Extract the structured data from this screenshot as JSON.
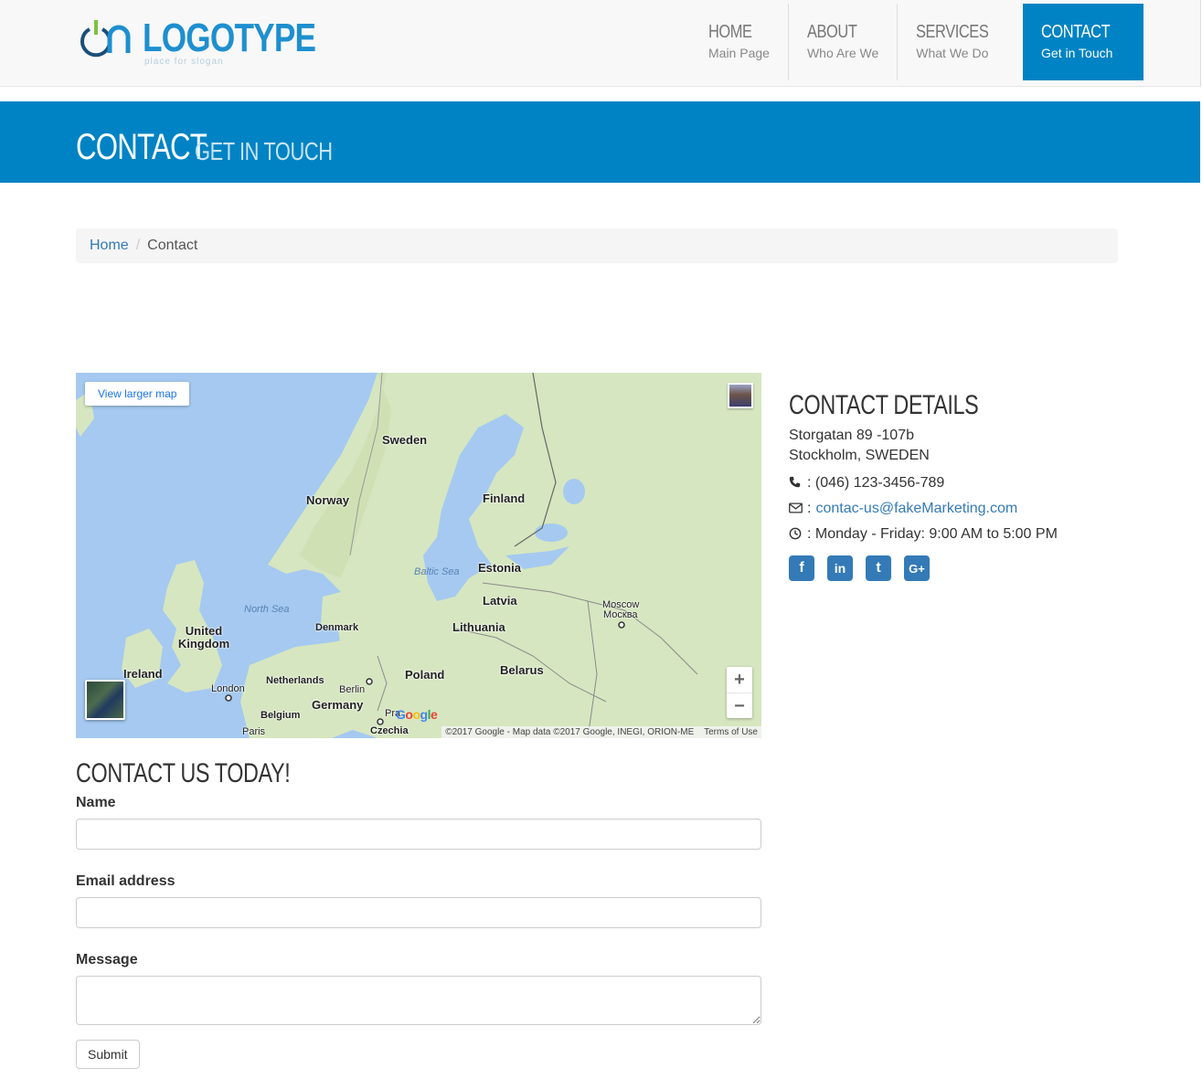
{
  "header": {
    "logo_text": "LOGOTYPE",
    "logo_slogan": "place for slogan",
    "nav": [
      {
        "title": "HOME",
        "subtitle": "Main Page",
        "active": false
      },
      {
        "title": "ABOUT",
        "subtitle": "Who Are We",
        "active": false
      },
      {
        "title": "SERVICES",
        "subtitle": "What We Do",
        "active": false
      },
      {
        "title": "CONTACT",
        "subtitle": "Get in Touch",
        "active": true
      }
    ]
  },
  "banner": {
    "title": "CONTACT",
    "subtitle": "GET IN TOUCH"
  },
  "breadcrumb": {
    "home": "Home",
    "separator": "/",
    "current": "Contact"
  },
  "map": {
    "larger_map_label": "View larger map",
    "zoom_in": "+",
    "zoom_out": "−",
    "attribution": "©2017 Google - Map data ©2017 Google, INEGI, ORION-ME",
    "terms": "Terms of Use",
    "google_logo": "Google",
    "labels": {
      "sweden": "Sweden",
      "norway": "Norway",
      "finland": "Finland",
      "estonia": "Estonia",
      "latvia": "Latvia",
      "lithuania": "Lithuania",
      "denmark": "Denmark",
      "united_kingdom": "United Kingdom",
      "ireland": "Ireland",
      "netherlands": "Netherlands",
      "belgium": "Belgium",
      "germany": "Germany",
      "poland": "Poland",
      "belarus": "Belarus",
      "czechia": "Czechia",
      "moscow": "Moscow",
      "moscow_ru": "Москва",
      "london": "London",
      "berlin": "Berlin",
      "paris": "Paris",
      "prague": "Pra",
      "north_sea": "North Sea",
      "baltic_sea": "Baltic Sea"
    }
  },
  "contact_details": {
    "heading": "CONTACT DETAILS",
    "address_line1": "Storgatan 89 -107b",
    "address_line2": "Stockholm, SWEDEN",
    "phone": ": (046) 123-3456-789",
    "email_prefix": ":",
    "email": "contac-us@fakeMarketing.com",
    "hours": ": Monday - Friday: 9:00 AM to 5:00 PM",
    "social": [
      {
        "name": "facebook-icon",
        "glyph": "f"
      },
      {
        "name": "linkedin-icon",
        "glyph": "in"
      },
      {
        "name": "twitter-icon",
        "glyph": "t"
      },
      {
        "name": "google-plus-icon",
        "glyph": "G+"
      }
    ]
  },
  "form": {
    "heading": "CONTACT US TODAY!",
    "name_label": "Name",
    "email_label": "Email address",
    "message_label": "Message",
    "submit_label": "Submit"
  },
  "colors": {
    "brand": "#0083c4",
    "link": "#337ab7"
  }
}
